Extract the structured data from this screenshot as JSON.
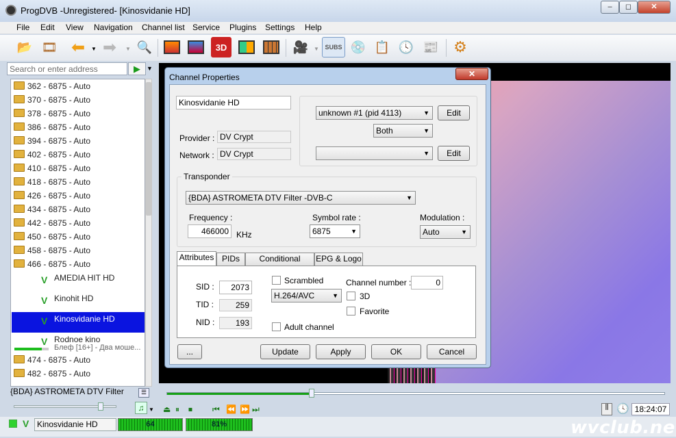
{
  "window": {
    "title": "ProgDVB -Unregistered-  [Kinosvidanie HD]",
    "min": "‒",
    "max": "◻",
    "close": "✕"
  },
  "menu": [
    "File",
    "Edit",
    "View",
    "Navigation",
    "Channel list",
    "Service",
    "Plugins",
    "Settings",
    "Help"
  ],
  "toolbar": {
    "subs_label": "SUBS"
  },
  "search": {
    "placeholder": "Search or enter address"
  },
  "transponders_top": [
    "362 - 6875 - Auto",
    "370 - 6875 - Auto",
    "378 - 6875 - Auto",
    "386 - 6875 - Auto",
    "394 - 6875 - Auto",
    "402 - 6875 - Auto",
    "410 - 6875 - Auto",
    "418 - 6875 - Auto",
    "426 - 6875 - Auto",
    "434 - 6875 - Auto",
    "442 - 6875 - Auto",
    "450 - 6875 - Auto",
    "458 - 6875 - Auto",
    "466 - 6875 - Auto"
  ],
  "channels": [
    {
      "name": "AMEDIA HIT HD",
      "selected": false
    },
    {
      "name": "Kinohit HD",
      "selected": false
    },
    {
      "name": "Kinosvidanie HD",
      "selected": true
    },
    {
      "name": "Rodnoe kino",
      "selected": false,
      "sub": "Блеф [16+] - Два моше...",
      "progress": 0.8
    }
  ],
  "transponders_bottom": [
    "474 - 6875 - Auto",
    "482 - 6875 - Auto"
  ],
  "source_name": "{BDA} ASTROMETA DTV Filter",
  "player": {
    "time": "18:24:07",
    "seek_progress": 0.29,
    "volume": 0.85
  },
  "status": {
    "channel": "Kinosvidanie HD",
    "level1": "64",
    "level2": "81%",
    "watermark": "wvclub.net"
  },
  "dialog": {
    "title": "Channel Properties",
    "close": "✕",
    "channel_name": "Kinosvidanie HD",
    "provider_label": "Provider :",
    "provider_value": "DV Crypt",
    "network_label": "Network :",
    "network_value": "DV Crypt",
    "audio_track": "unknown #1 (pid 4113)",
    "audio_mode": "Both",
    "subtitle_track": "",
    "edit1": "Edit",
    "edit2": "Edit",
    "transponder_group": "Transponder",
    "transponder_device": "{BDA} ASTROMETA DTV Filter -DVB-C",
    "frequency_label": "Frequency :",
    "frequency_value": "466000",
    "frequency_unit": "KHz",
    "symbol_rate_label": "Symbol rate :",
    "symbol_rate_value": "6875",
    "modulation_label": "Modulation :",
    "modulation_value": "Auto",
    "tabs": [
      "Attributes",
      "PIDs",
      "Conditional Access",
      "EPG & Logo"
    ],
    "sid_label": "SID :",
    "sid_value": "2073",
    "tid_label": "TID :",
    "tid_value": "259",
    "nid_label": "NID :",
    "nid_value": "193",
    "scrambled_label": "Scrambled",
    "codec_value": "H.264/AVC",
    "adult_label": "Adult channel",
    "channel_number_label": "Channel number :",
    "channel_number_value": "0",
    "threed_label": "3D",
    "favorite_label": "Favorite",
    "more_button": "...",
    "update_button": "Update",
    "apply_button": "Apply",
    "ok_button": "OK",
    "cancel_button": "Cancel"
  }
}
